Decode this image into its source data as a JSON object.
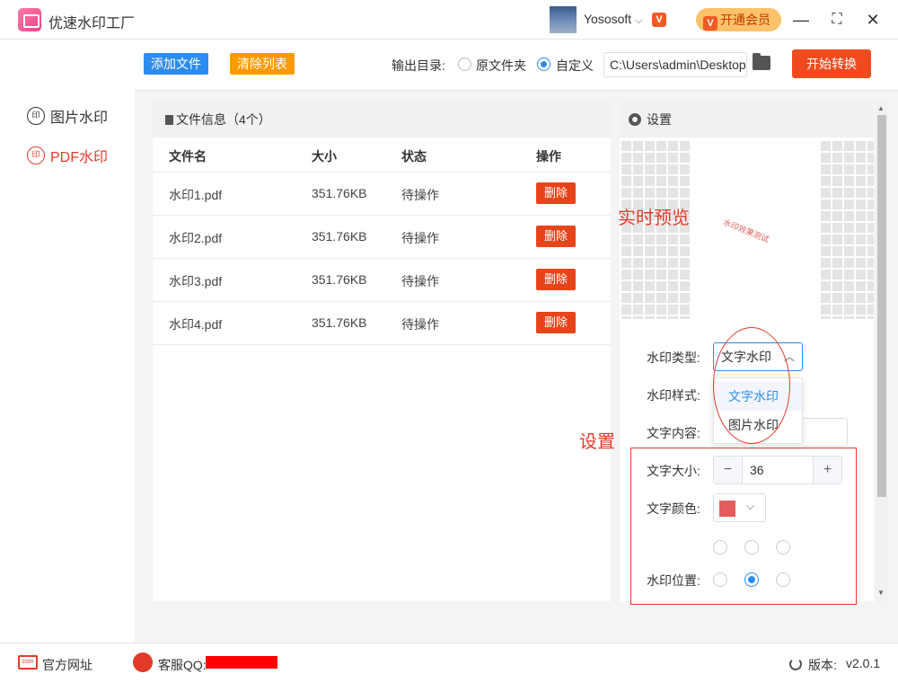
{
  "app": {
    "title": "优速水印工厂"
  },
  "header": {
    "username": "Yososoft",
    "vip_label": "开通会员",
    "vip_icon": "V"
  },
  "window": {
    "minimize": "—",
    "maximize": "⛶",
    "close": "✕"
  },
  "sidebar": {
    "items": [
      {
        "label": "图片水印",
        "icon": "印"
      },
      {
        "label": "PDF水印",
        "icon": "印"
      }
    ]
  },
  "toolbar": {
    "add_files": "添加文件",
    "clear_list": "清除列表",
    "output_dir_label": "输出目录:",
    "option_original": "原文件夹",
    "option_custom": "自定义",
    "path_value": "C:\\Users\\admin\\Desktop",
    "start_button": "开始转换"
  },
  "files": {
    "panel_title": "文件信息（4个）",
    "columns": [
      "文件名",
      "大小",
      "状态",
      "操作"
    ],
    "rows": [
      {
        "name": "水印1.pdf",
        "size": "351.76KB",
        "status": "待操作",
        "action": "删除"
      },
      {
        "name": "水印2.pdf",
        "size": "351.76KB",
        "status": "待操作",
        "action": "删除"
      },
      {
        "name": "水印3.pdf",
        "size": "351.76KB",
        "status": "待操作",
        "action": "删除"
      },
      {
        "name": "水印4.pdf",
        "size": "351.76KB",
        "status": "待操作",
        "action": "删除"
      }
    ]
  },
  "settings": {
    "title": "设置",
    "preview_watermark": "水印效果测试",
    "watermark_type_label": "水印类型:",
    "watermark_type_value": "文字水印",
    "type_options": [
      "文字水印",
      "图片水印"
    ],
    "watermark_style_label": "水印样式:",
    "text_content_label": "文字内容:",
    "font_size_label": "文字大小:",
    "font_size_value": "36",
    "font_color_label": "文字颜色:",
    "font_color": "#e55c5c",
    "position_label": "水印位置:",
    "position_selected": "middle-center"
  },
  "annotations": {
    "preview": "实时预览",
    "settings": "设置"
  },
  "footer": {
    "website": "官方网址",
    "qq_label": "客服QQ:",
    "version_label": "版本:",
    "version_value": "v2.0.1"
  },
  "colors": {
    "accent": "#2d8cf0",
    "danger": "#e8441a",
    "orange": "#ff9900",
    "start": "#f04b1e"
  }
}
